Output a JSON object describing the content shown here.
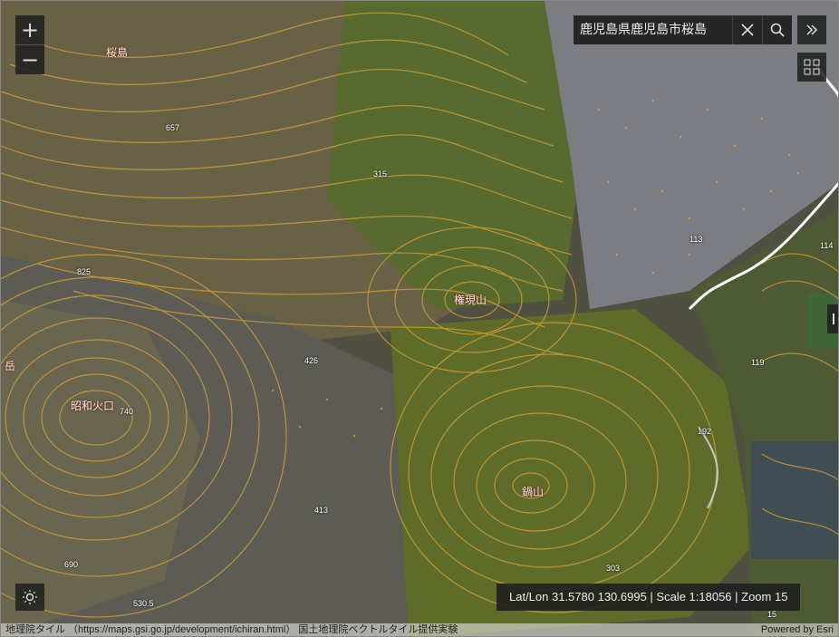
{
  "search": {
    "value": "鹿児島県鹿児島市桜島"
  },
  "zoom_controls": {
    "in": "+",
    "out": "−"
  },
  "places": [
    {
      "id": "sakurajima",
      "label": "桜島"
    },
    {
      "id": "gongenyama",
      "label": "権現山"
    },
    {
      "id": "showa-crater",
      "label": "昭和火口"
    },
    {
      "id": "nabeyama",
      "label": "鍋山"
    },
    {
      "id": "edge-dake",
      "label": "岳"
    }
  ],
  "elevations": [
    "657",
    "315",
    "825",
    "426",
    "740",
    "413",
    "690",
    "530.5",
    "303",
    "113",
    "114",
    "119",
    "192",
    "15"
  ],
  "status": {
    "coordinates": "Lat/Lon 31.5780 130.6995 | Scale 1:18056 | Zoom 15"
  },
  "attribution": {
    "left": "地理院タイル （https://maps.gsi.go.jp/development/ichiran.html） 国土地理院ベクトルタイル提供実験",
    "right": "Powered by Esri"
  },
  "colors": {
    "contour": "#d9a53a",
    "terrain_green": "#5b6a2c",
    "ash": "#7d7d80",
    "road": "#ffffff"
  }
}
